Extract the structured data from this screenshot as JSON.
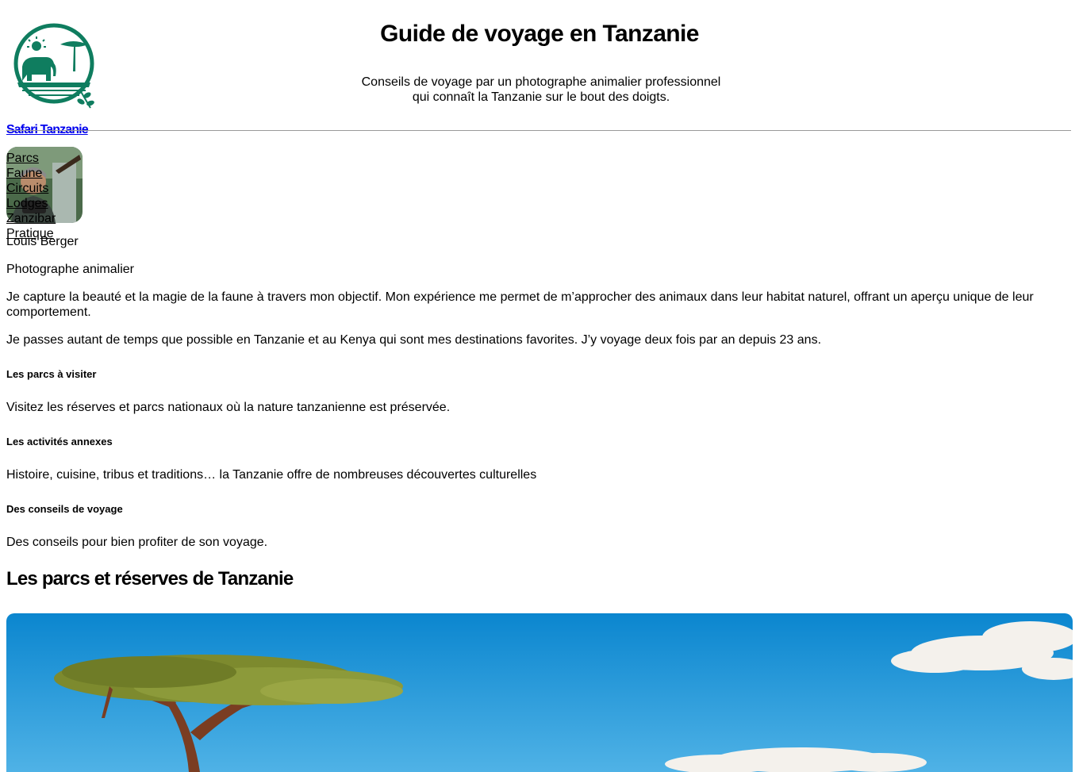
{
  "header": {
    "site_title": "Guide de voyage en Tanzanie",
    "tagline_line1": "Conseils de voyage par un photographe animalier professionnel",
    "tagline_line2": "qui connaît la Tanzanie sur le bout des doigts.",
    "logo_icon": "elephant-acacia-logo-icon",
    "brand_link": "Safari Tanzanie"
  },
  "nav": {
    "items": [
      "Parcs",
      "Faune",
      "Circuits",
      "Lodges",
      "Zanzibar",
      "Pratique"
    ]
  },
  "author": {
    "name": "Louis Berger",
    "role": "Photographe animalier",
    "bio1": "Je capture la beauté et la magie de la faune à travers mon objectif. Mon expérience me permet de m’approcher des animaux dans leur habitat naturel, offrant un aperçu unique de leur comportement.",
    "bio2": "Je passes autant de temps que possible en Tanzanie et au Kenya qui sont mes destinations favorites. J’y voyage deux fois par an depuis 23 ans."
  },
  "sections": [
    {
      "title": "Les parcs à visiter",
      "text": "Visitez les réserves et parcs nationaux où la nature tanzanienne est préservée."
    },
    {
      "title": "Les activités annexes",
      "text": "Histoire, cuisine, tribus et traditions… la Tanzanie offre de nombreuses découvertes culturelles"
    },
    {
      "title": "Des conseils de voyage",
      "text": "Des conseils pour bien profiter de son voyage."
    }
  ],
  "parks": {
    "heading": "Les parcs et réserves de Tanzanie"
  },
  "colors": {
    "logo_green": "#0f7d5f",
    "link_blue": "#0000ee",
    "sky_blue": "#1b93d6"
  }
}
